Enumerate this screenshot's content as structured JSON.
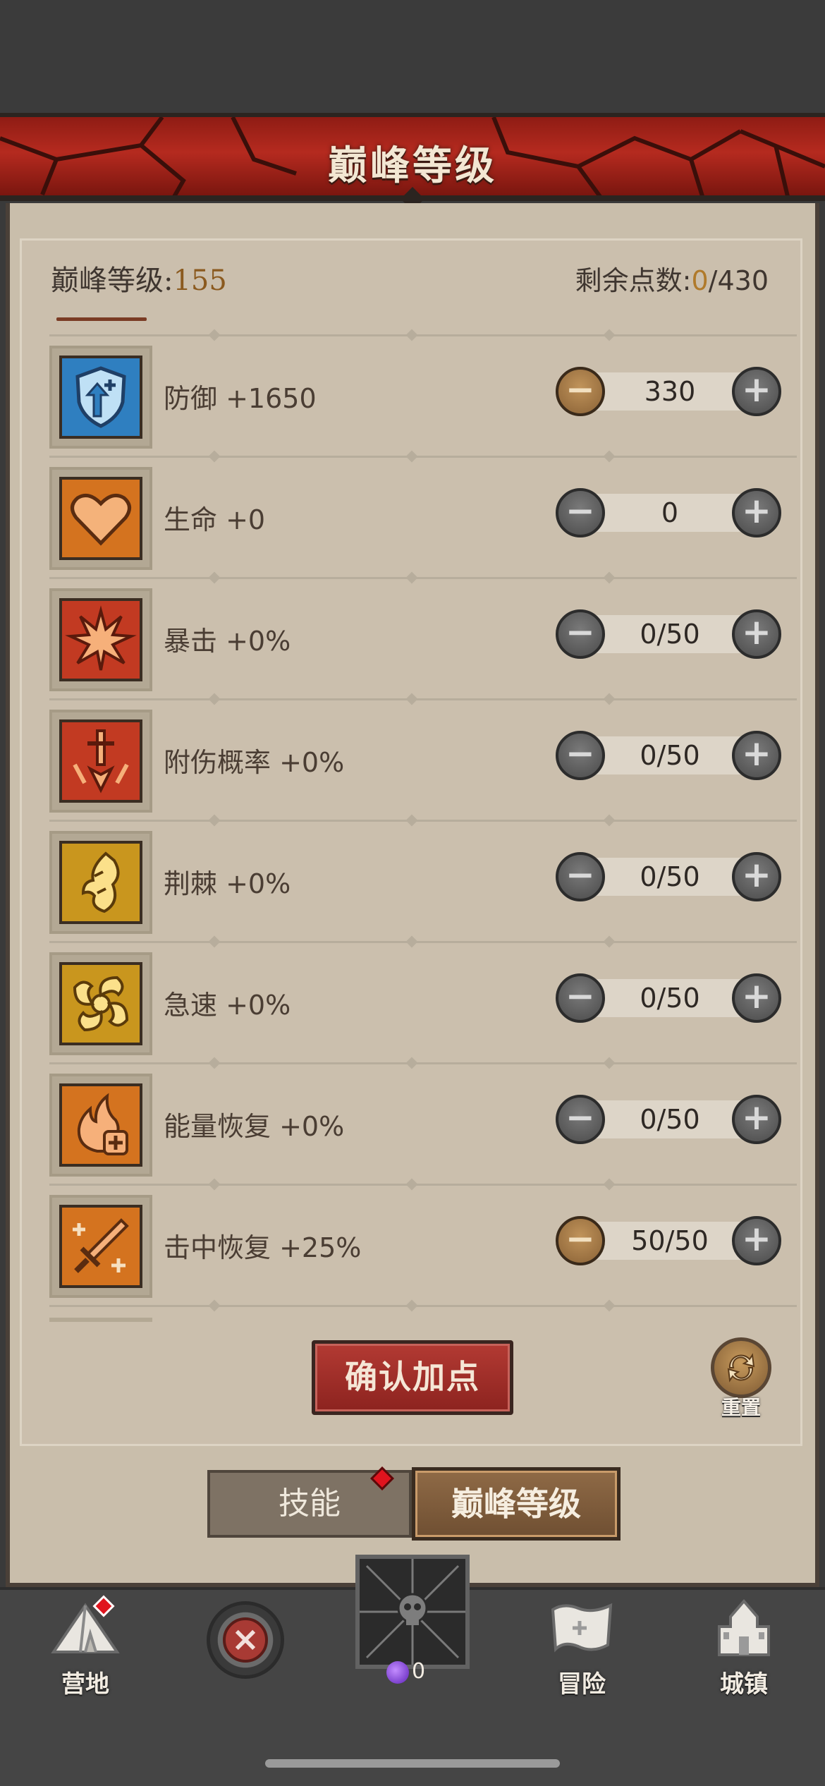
{
  "header": {
    "title": "巅峰等级"
  },
  "summary": {
    "level_prefix": "巅峰等级:",
    "level_value": "155",
    "points_prefix": "剩余点数:",
    "points_current": "0",
    "points_total": "/430"
  },
  "attributes": [
    {
      "name": "防御 +1650",
      "value": "330",
      "icon": "shield-arrow-icon",
      "minus_active": true,
      "color": "#2f7fc0"
    },
    {
      "name": "生命 +0",
      "value": "0",
      "icon": "heart-icon",
      "minus_active": false,
      "color": "#d4731f"
    },
    {
      "name": "暴击 +0%",
      "value": "0/50",
      "icon": "burst-icon",
      "minus_active": false,
      "color": "#c23a22"
    },
    {
      "name": "附伤概率 +0%",
      "value": "0/50",
      "icon": "sword-down-icon",
      "minus_active": false,
      "color": "#c23a22"
    },
    {
      "name": "荆棘 +0%",
      "value": "0/50",
      "icon": "thorn-icon",
      "minus_active": false,
      "color": "#c9961e"
    },
    {
      "name": "急速 +0%",
      "value": "0/50",
      "icon": "swirl-icon",
      "minus_active": false,
      "color": "#c9961e"
    },
    {
      "name": "能量恢复 +0%",
      "value": "0/50",
      "icon": "flame-plus-icon",
      "minus_active": false,
      "color": "#d4731f"
    },
    {
      "name": "击中恢复 +25%",
      "value": "50/50",
      "icon": "sword-plus-icon",
      "minus_active": true,
      "color": "#d4731f"
    }
  ],
  "actions": {
    "confirm_label": "确认加点",
    "reset_label": "重置"
  },
  "tabs": [
    {
      "label": "技能",
      "active": false,
      "badge": true
    },
    {
      "label": "巅峰等级",
      "active": true,
      "badge": false
    }
  ],
  "bottom_nav": {
    "camp_label": "营地",
    "adventure_label": "冒险",
    "town_label": "城镇",
    "orb_count": "0"
  }
}
